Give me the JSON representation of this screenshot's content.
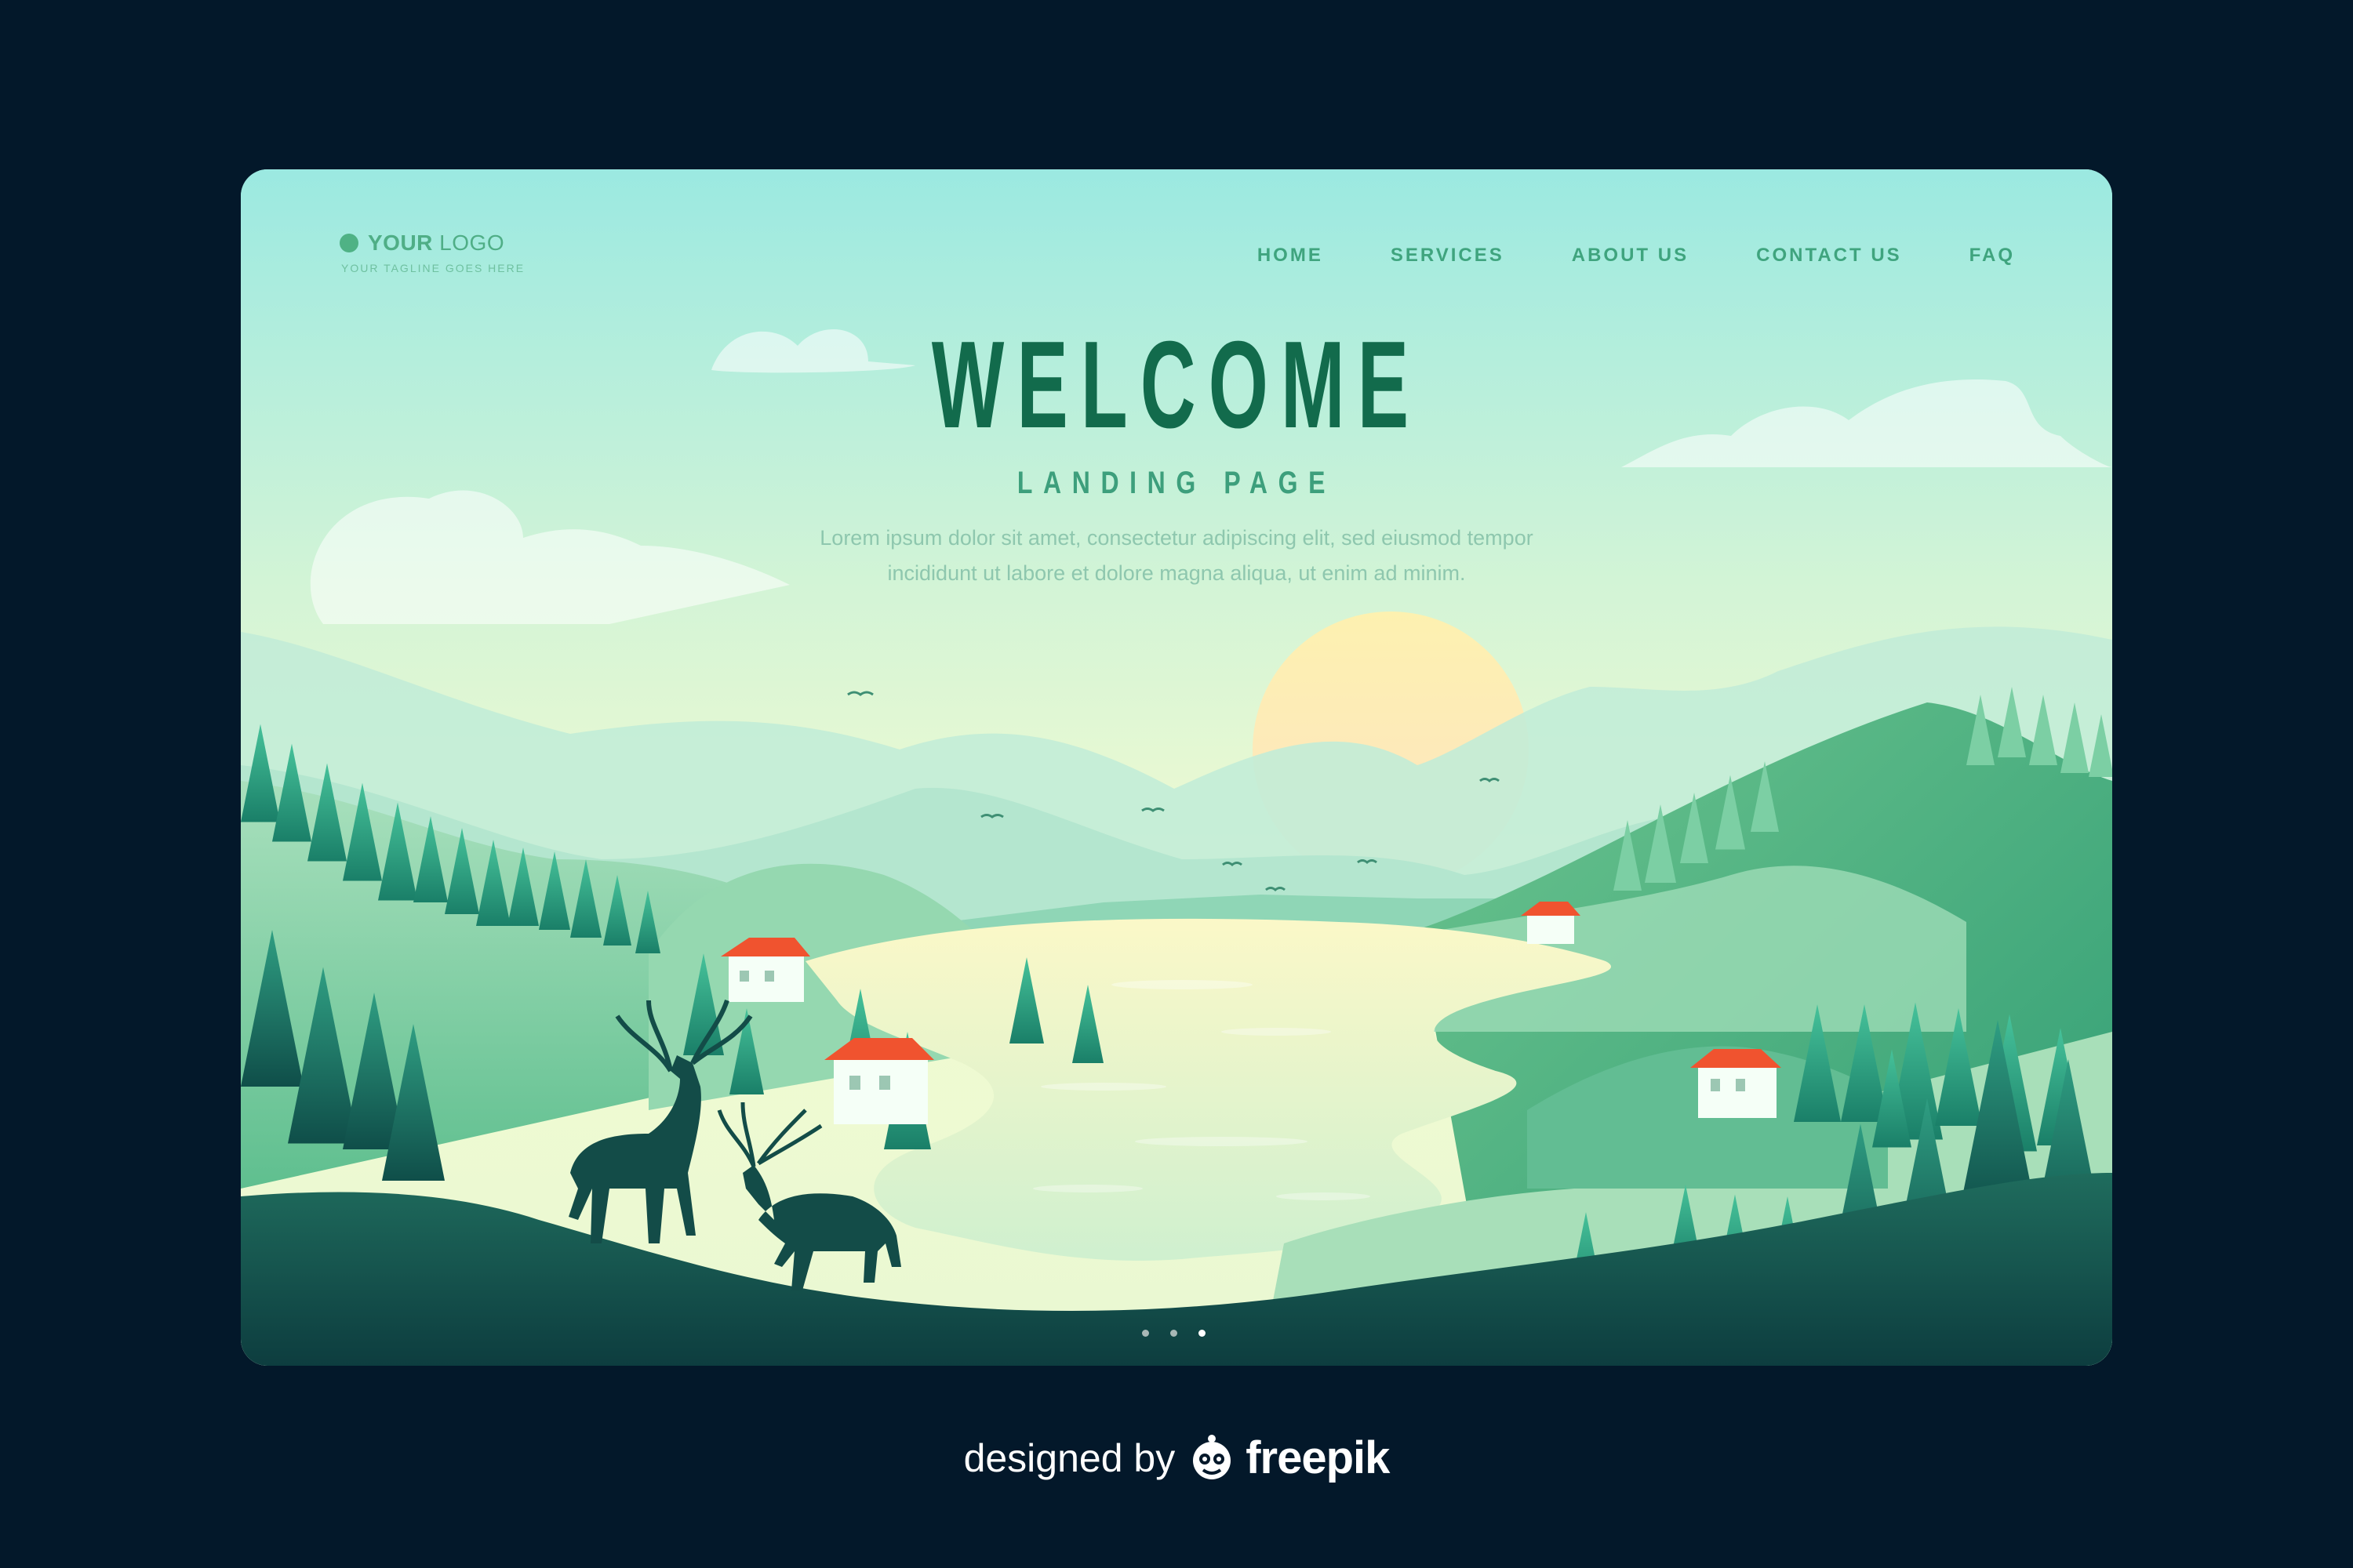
{
  "header": {
    "logo_bold": "YOUR",
    "logo_light": " LOGO",
    "tagline": "YOUR TAGLINE GOES HERE"
  },
  "nav": {
    "items": [
      "HOME",
      "SERVICES",
      "ABOUT US",
      "CONTACT US",
      "FAQ"
    ]
  },
  "hero": {
    "title": "WELCOME",
    "subtitle": "LANDING PAGE",
    "body_line1": "Lorem ipsum dolor sit amet, consectetur adipiscing elit, sed eiusmod tempor",
    "body_line2": "incididunt ut labore et dolore magna aliqua, ut enim ad minim."
  },
  "carousel": {
    "slide_count": 3,
    "active_index": 2
  },
  "footer": {
    "credit_prefix": "designed by",
    "brand": "freepik"
  },
  "colors": {
    "page_background": "#03182a",
    "title": "#126b4c",
    "accent": "#4fb285",
    "sun": "#fbeab6",
    "roof": "#f0532f"
  },
  "icons": [
    "logo-dot-icon",
    "freepik-logo-icon",
    "bird-icon",
    "deer-icon",
    "house-icon"
  ]
}
